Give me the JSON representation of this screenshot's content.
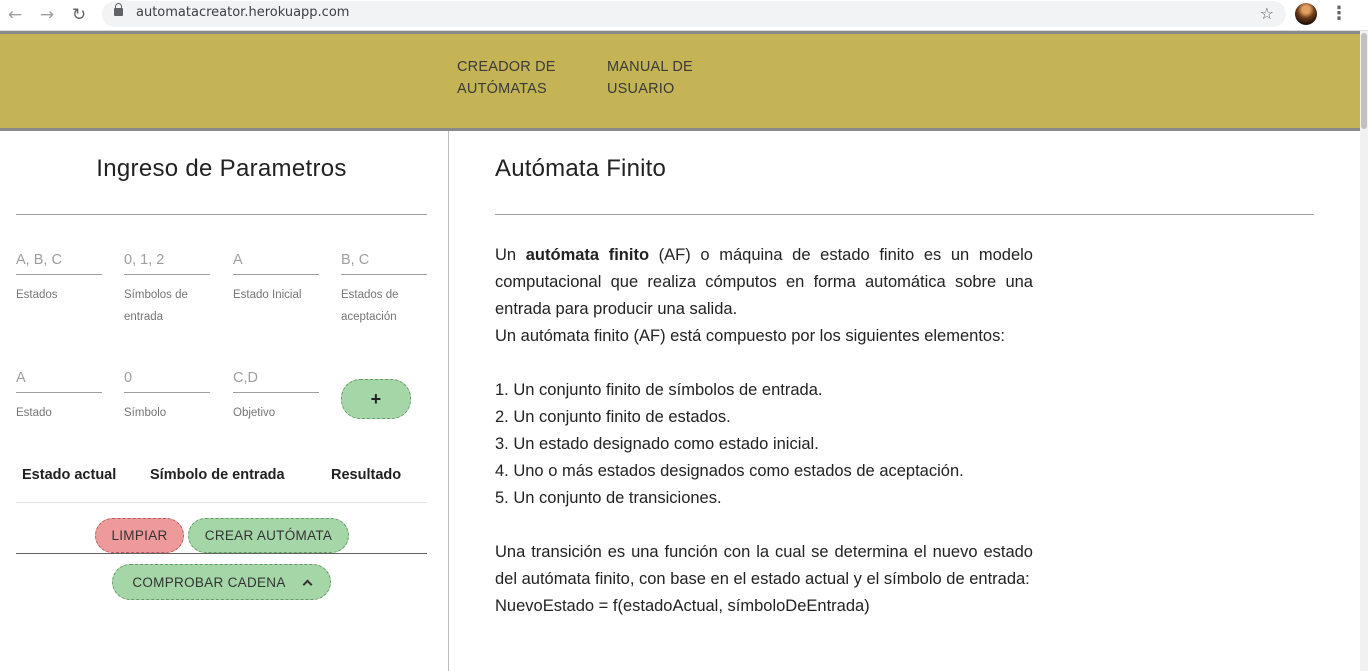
{
  "browser": {
    "url": "automatacreator.herokuapp.com"
  },
  "header": {
    "menu": [
      {
        "line1": "CREADOR DE",
        "line2": "AUTÓMATAS"
      },
      {
        "line1": "MANUAL DE",
        "line2": "USUARIO"
      }
    ]
  },
  "left": {
    "title": "Ingreso de Parametros",
    "fields_row1": [
      {
        "placeholder": "A, B, C",
        "label": "Estados"
      },
      {
        "placeholder": "0, 1, 2",
        "label": "Símbolos de entrada"
      },
      {
        "placeholder": "A",
        "label": "Estado Inicial"
      },
      {
        "placeholder": "B, C",
        "label": "Estados de aceptación"
      }
    ],
    "fields_row2": [
      {
        "placeholder": "A",
        "label": "Estado"
      },
      {
        "placeholder": "0",
        "label": "Símbolo"
      },
      {
        "placeholder": "C,D",
        "label": "Objetivo"
      }
    ],
    "add_label": "+",
    "table_headers": [
      "Estado actual",
      "Símbolo de entrada",
      "Resultado"
    ],
    "clear_label": "LIMPIAR",
    "create_label": "CREAR AUTÓMATA",
    "check_label": "COMPROBAR CADENA"
  },
  "right": {
    "title": "Autómata Finito",
    "intro_prefix": "Un ",
    "intro_bold": "autómata finito",
    "intro_rest": " (AF) o máquina de estado finito es un modelo computacional que realiza cómputos en forma automática sobre una entrada para producir una salida.",
    "composed": "Un autómata finito (AF) está compuesto por los siguientes elementos:",
    "items": [
      "1. Un conjunto finito de símbolos de entrada.",
      "2. Un conjunto finito de estados.",
      "3. Un estado designado como estado inicial.",
      "4. Uno o más estados designados como estados de aceptación.",
      "5. Un conjunto de transiciones."
    ],
    "transition": "Una transición es una función con la cual se determina el nuevo estado del autómata finito, con base en el estado actual y el símbolo de entrada:",
    "formula": "NuevoEstado = f(estadoActual, símboloDeEntrada)"
  }
}
